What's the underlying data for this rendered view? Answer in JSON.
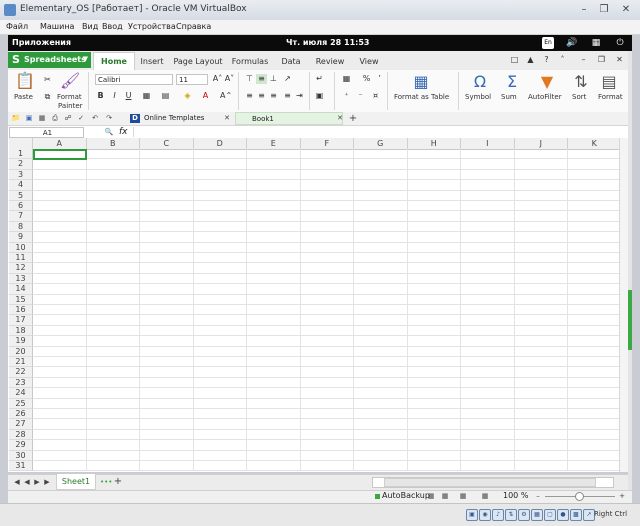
{
  "vbox": {
    "title": "Elementary_OS [Работает] - Oracle VM VirtualBox",
    "menu": [
      "Файл",
      "Машина",
      "Вид",
      "Ввод",
      "Устройства",
      "Справка"
    ],
    "host_key": "Right Ctrl"
  },
  "guest_panel": {
    "apps": "Приложения",
    "datetime": "Чт. июля 28   11:53",
    "lang": "En"
  },
  "app": {
    "name": "Spreadsheets",
    "tabs": [
      "Home",
      "Insert",
      "Page Layout",
      "Formulas",
      "Data",
      "Review",
      "View"
    ],
    "active_tab": "Home"
  },
  "ribbon": {
    "paste": "Paste",
    "format_painter_1": "Format",
    "format_painter_2": "Painter",
    "font": "Calibri",
    "size": "11",
    "bold": "B",
    "italic": "I",
    "underline": "U",
    "percent": "%",
    "format_as_table": "Format as Table",
    "symbol": "Symbol",
    "sum": "Sum",
    "autofilter": "AutoFilter",
    "sort": "Sort",
    "format": "Format"
  },
  "doc_tabs": {
    "templates": "Online Templates",
    "book": "Book1"
  },
  "formula_bar": {
    "cell_ref": "A1",
    "fx": "fx"
  },
  "grid": {
    "columns": [
      "A",
      "B",
      "C",
      "D",
      "E",
      "F",
      "G",
      "H",
      "I",
      "J",
      "K"
    ],
    "rows": [
      "1",
      "2",
      "3",
      "4",
      "5",
      "6",
      "7",
      "8",
      "9",
      "10",
      "11",
      "12",
      "13",
      "14",
      "15",
      "16",
      "17",
      "18",
      "19",
      "20",
      "21",
      "22",
      "23",
      "24",
      "25",
      "26",
      "27",
      "28",
      "29",
      "30",
      "31"
    ],
    "selected": "A1"
  },
  "sheets": {
    "active": "Sheet1"
  },
  "status": {
    "autobackup": "AutoBackup",
    "zoom": "100 %"
  },
  "colors": {
    "accent": "#2f9a3c",
    "selection": "#2f9a3c"
  }
}
